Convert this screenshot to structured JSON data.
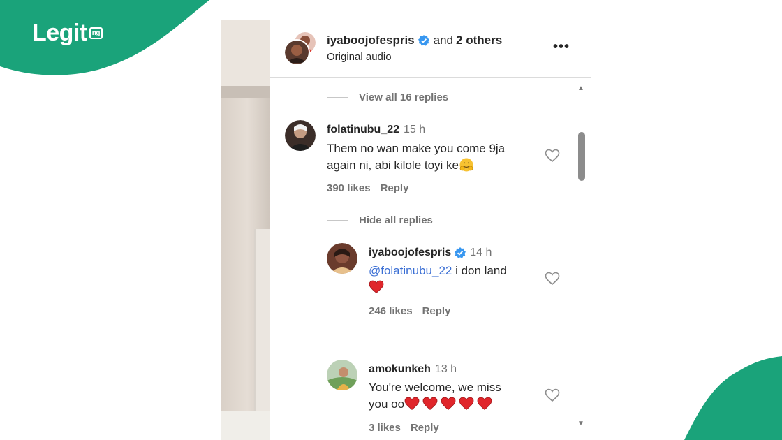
{
  "branding": {
    "logo_text": "Legit",
    "logo_suffix": "ng",
    "accent": "#1aa37a"
  },
  "post_header": {
    "title_user": "iyaboojofespris",
    "title_and": "and",
    "title_others": "2 others",
    "subtitle": "Original audio",
    "more_label": "•••"
  },
  "thread": {
    "view_all_label": "View all 16 replies",
    "hide_all_label": "Hide all replies",
    "comments": [
      {
        "username": "folatinubu_22",
        "time": "15 h",
        "text": "Them no wan make you come 9ja again ni, abi kilole toyi ke",
        "likes": "390 likes",
        "reply": "Reply"
      }
    ],
    "replies": [
      {
        "username": "iyaboojofespris",
        "time": "14 h",
        "mention": "@folatinubu_22",
        "text": "i don land",
        "likes": "246 likes",
        "reply": "Reply"
      },
      {
        "username": "amokunkeh",
        "time": "13 h",
        "text_line1": "You're welcome, we miss",
        "text_line2": "you oo",
        "likes": "3 likes",
        "reply": "Reply"
      }
    ]
  }
}
